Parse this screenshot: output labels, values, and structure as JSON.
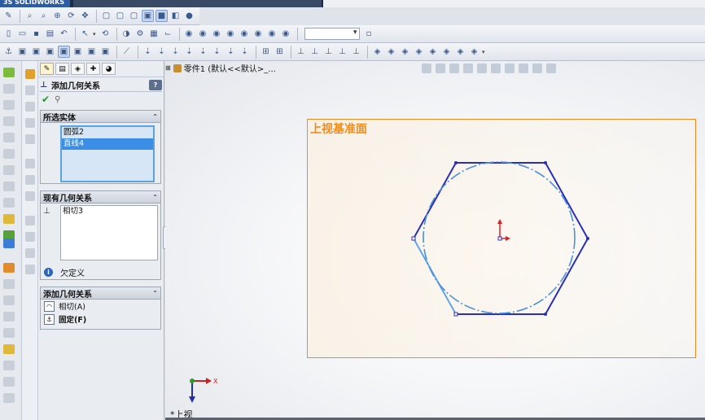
{
  "app": {
    "logo_text": "3S SOLIDWORKS"
  },
  "colors": {
    "plane_border": "#f08c1e",
    "sketch_line": "#2a2fb8",
    "construction": "#4a90e2",
    "accept": "#1e9a2c",
    "selection": "#3a8ee6"
  },
  "toolbar1": {
    "icons": [
      "smart-dimension-icon",
      "zoom-fit-icon",
      "zoom-area-icon",
      "rotate-icon",
      "pan-icon",
      "view-orient-icon",
      "wireframe-icon",
      "hidden-lines-icon",
      "shaded-edges-icon",
      "shaded-icon",
      "section-view-icon",
      "appearance-icon"
    ]
  },
  "toolbar2": {
    "combo_value": ""
  },
  "property_manager": {
    "title": "添加几何关系",
    "help": "?",
    "selected_entities": {
      "header": "所选实体",
      "items": [
        "圆弧2",
        "直线4"
      ],
      "highlighted_index": 1
    },
    "existing_relations": {
      "header": "现有几何关系",
      "items": [
        "相切3"
      ],
      "status": "欠定义",
      "status_icon": "info-icon"
    },
    "add_relations": {
      "header": "添加几何关系",
      "items": [
        {
          "label": "相切(A)",
          "icon": "tangent-icon"
        },
        {
          "label": "固定(F)",
          "icon": "fix-icon"
        }
      ]
    }
  },
  "graphics": {
    "tree_item": "零件1 (默认<<默认>_...",
    "plane_label": "上视基准面",
    "view_label": "*上视",
    "triad_axis_x": "X"
  }
}
